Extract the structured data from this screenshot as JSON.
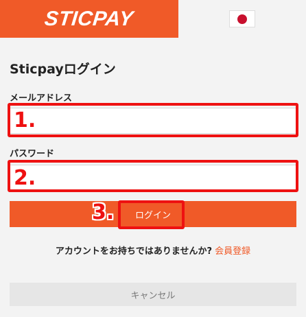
{
  "header": {
    "logo_text": "STICPAY",
    "language_flag": "japan-flag-icon"
  },
  "form": {
    "title": "Sticpayログイン",
    "email_label": "メールアドレス",
    "email_value": "",
    "password_label": "パスワード",
    "password_value": "",
    "login_button": "ログイン"
  },
  "signup": {
    "question": "アカウントをお持ちではありませんか?",
    "link": "会員登録"
  },
  "cancel_button": "キャンセル",
  "annotations": {
    "step1": "1.",
    "step2": "2.",
    "step3": "3."
  },
  "colors": {
    "brand_orange": "#f05a28",
    "highlight_red": "#ee1111",
    "flag_red": "#c8102e"
  }
}
